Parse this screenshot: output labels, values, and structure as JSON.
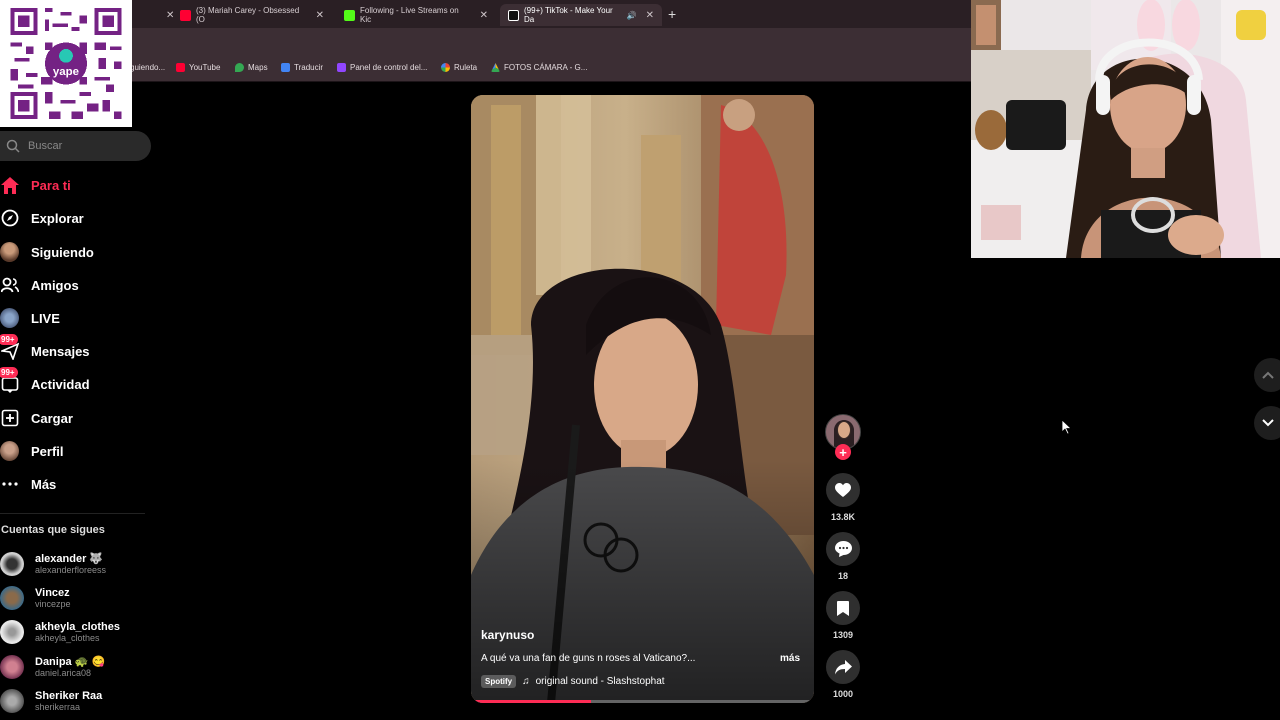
{
  "browser": {
    "tabs": [
      {
        "title": "(3) Mariah Carey - Obsessed (O",
        "favicon_color": "#ff0033"
      },
      {
        "title": "Following - Live Streams on Kic",
        "favicon_color": "#53fc18"
      },
      {
        "title": "(99+) TikTok - Make Your Da",
        "favicon_color": "#ffffff"
      }
    ],
    "address_fragment": "n",
    "bookmarks": [
      {
        "label": "guiendo...",
        "color": "#888888"
      },
      {
        "label": "YouTube",
        "color": "#ff0033"
      },
      {
        "label": "Maps",
        "color": "#34a853"
      },
      {
        "label": "Traducir",
        "color": "#4285f4"
      },
      {
        "label": "Panel de control del...",
        "color": "#9146ff"
      },
      {
        "label": "Ruleta",
        "color": "#ea4335"
      },
      {
        "label": "FOTOS CÁMARA - G...",
        "color": "#fbbc04"
      }
    ]
  },
  "overlay": {
    "qr_brand": "yape",
    "qr_color": "#742284"
  },
  "sidebar": {
    "search_placeholder": "Buscar",
    "nav": [
      {
        "label": "Para ti",
        "icon": "home-icon",
        "active": true
      },
      {
        "label": "Explorar",
        "icon": "compass-icon"
      },
      {
        "label": "Siguiendo",
        "icon": "avatar"
      },
      {
        "label": "Amigos",
        "icon": "friends-icon"
      },
      {
        "label": "LIVE",
        "icon": "avatar"
      },
      {
        "label": "Mensajes",
        "icon": "message-icon",
        "badge": "99+"
      },
      {
        "label": "Actividad",
        "icon": "inbox-icon",
        "badge": "99+"
      },
      {
        "label": "Cargar",
        "icon": "upload-icon"
      },
      {
        "label": "Perfil",
        "icon": "avatar"
      },
      {
        "label": "Más",
        "icon": "more-icon"
      }
    ],
    "following_title": "Cuentas que sigues",
    "following": [
      {
        "name": "alexander 🐺",
        "username": "alexanderfloreess",
        "color": "#cfcfcf"
      },
      {
        "name": "Vincez",
        "username": "vincezpe",
        "color": "#3a6a8a"
      },
      {
        "name": "akheyla_clothes",
        "username": "akheyla_clothes",
        "color": "#e8e8e8"
      },
      {
        "name": "Danipa 🐢 😋",
        "username": "daniel.arica08",
        "color": "#b04070"
      },
      {
        "name": "Sheriker Raa",
        "username": "sherikerraa",
        "color": "#777777"
      }
    ]
  },
  "video": {
    "username": "karynuso",
    "caption": "A qué va una fan de guns n roses al Vaticano?...",
    "more_label": "más",
    "spotify_label": "Spotify",
    "music": "original sound - Slashstophat",
    "progress": 0.35
  },
  "actions": {
    "likes": "13.8K",
    "comments": "18",
    "saves": "1309",
    "shares": "1000",
    "follow_label": "+"
  },
  "colors": {
    "accent": "#fe2c55",
    "background": "#000000",
    "browser_bg": "#3c2e34"
  }
}
